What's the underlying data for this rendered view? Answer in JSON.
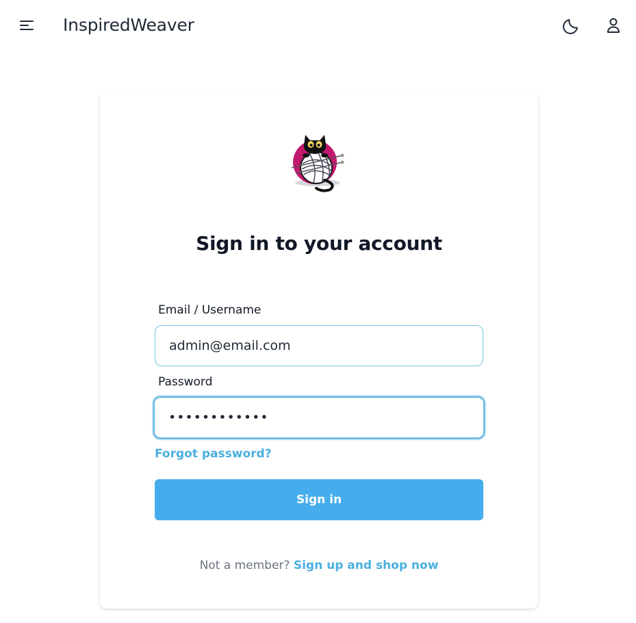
{
  "header": {
    "brand": "InspiredWeaver",
    "icons": {
      "menu": "menu-icon",
      "theme": "moon-icon",
      "user": "user-icon"
    }
  },
  "login": {
    "title": "Sign in to your account",
    "email_label": "Email / Username",
    "email_value": "admin@email.com",
    "password_label": "Password",
    "password_value": "••••••••••••",
    "forgot_label": "Forgot password?",
    "signin_label": "Sign in",
    "not_member": "Not a member?",
    "signup_label": "Sign up and shop now"
  },
  "colors": {
    "accent": "#45adeb",
    "link": "#4aafe0",
    "logo_circle": "#c2186e"
  }
}
